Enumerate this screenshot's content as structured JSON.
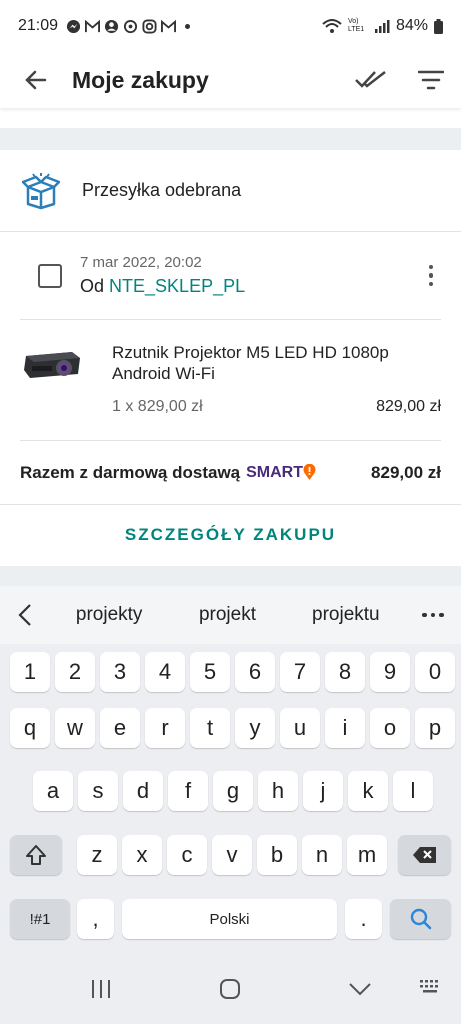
{
  "status": {
    "time": "21:09",
    "network": "Vo) LTE1",
    "battery": "84%"
  },
  "appbar": {
    "title": "Moje zakupy"
  },
  "shipment": {
    "label": "Przesyłka odebrana"
  },
  "order": {
    "date": "7 mar 2022, 20:02",
    "from_label": "Od",
    "seller": "NTE_SKLEP_PL",
    "item_name_line1": "Rzutnik Projektor M5 LED HD 1080p",
    "item_name_line2": "Android Wi-Fi",
    "qty_price": "1 x 829,00 zł",
    "item_total": "829,00 zł",
    "sum_label": "Razem z darmową dostawą",
    "smart_label": "SMART",
    "sum_value": "829,00 zł",
    "details_button": "SZCZEGÓŁY ZAKUPU"
  },
  "keyboard": {
    "suggestions": [
      "projekty",
      "projekt",
      "projektu"
    ],
    "row_numbers": [
      "1",
      "2",
      "3",
      "4",
      "5",
      "6",
      "7",
      "8",
      "9",
      "0"
    ],
    "row1": [
      "q",
      "w",
      "e",
      "r",
      "t",
      "y",
      "u",
      "i",
      "o",
      "p"
    ],
    "row2": [
      "a",
      "s",
      "d",
      "f",
      "g",
      "h",
      "j",
      "k",
      "l"
    ],
    "row3": [
      "z",
      "x",
      "c",
      "v",
      "b",
      "n",
      "m"
    ],
    "sym_key": "!#1",
    "comma_key": ",",
    "space_label": "Polski",
    "dot_key": "."
  },
  "colors": {
    "accent": "#00857c",
    "smart": "#4a2a7a",
    "smart_pin": "#ff6a00",
    "search_icon": "#2a86d8"
  }
}
